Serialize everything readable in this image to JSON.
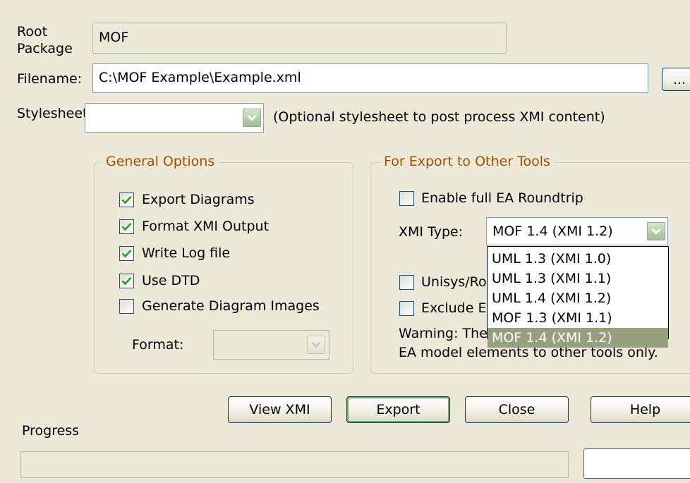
{
  "root_package": {
    "label": "Root\nPackage",
    "value": "MOF"
  },
  "filename": {
    "label": "Filename:",
    "value": "C:\\MOF Example\\Example.xml",
    "browse_label": "..."
  },
  "stylesheet": {
    "label": "Stylesheet",
    "value": "",
    "hint": "(Optional stylesheet to post process XMI content)"
  },
  "general_options": {
    "title": "General Options",
    "checkboxes": [
      {
        "label": "Export Diagrams",
        "checked": true
      },
      {
        "label": "Format XMI Output",
        "checked": true
      },
      {
        "label": "Write Log file",
        "checked": true
      },
      {
        "label": "Use DTD",
        "checked": true
      },
      {
        "label": "Generate Diagram Images",
        "checked": false
      }
    ],
    "format": {
      "label": "Format:",
      "value": "",
      "disabled": true
    }
  },
  "export_other_tools": {
    "title": "For Export to Other Tools",
    "enable_roundtrip": {
      "label": "Enable full EA Roundtrip",
      "checked": false
    },
    "xmi_type": {
      "label": "XMI Type:",
      "value": "MOF 1.4 (XMI 1.2)",
      "options": [
        "UML 1.3 (XMI 1.0)",
        "UML 1.3 (XMI 1.1)",
        "UML 1.4 (XMI 1.2)",
        "MOF 1.3 (XMI 1.1)",
        "MOF 1.4 (XMI 1.2)"
      ],
      "selected_option": "MOF 1.4 (XMI 1.2)"
    },
    "unisys": {
      "label": "Unisys/Ro",
      "checked": false
    },
    "exclude": {
      "label": "Exclude E",
      "checked": false
    },
    "warning_line1": "Warning: The",
    "warning_line2": "EA model elements to other tools only."
  },
  "buttons": {
    "view_xmi": "View XMI",
    "export": "Export",
    "close": "Close",
    "help": "Help"
  },
  "progress": {
    "label": "Progress",
    "value": 0
  },
  "colors": {
    "group_title": "#a24e00",
    "checkmark": "#21a121",
    "dropdown_button": "#9fbe92",
    "list_selection": "#94a07e",
    "dialog_bg": "#ece9d8"
  }
}
